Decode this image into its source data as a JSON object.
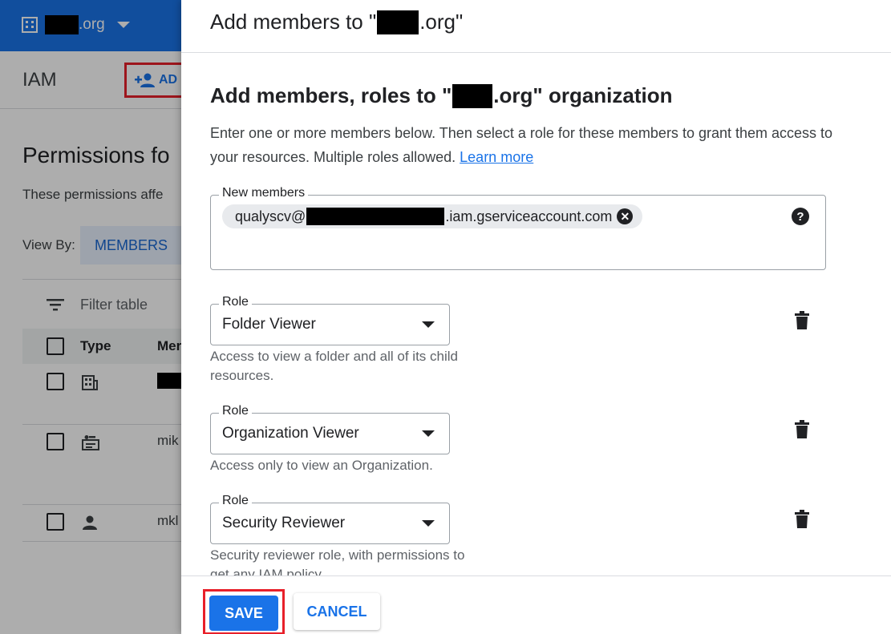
{
  "background": {
    "org_suffix": ".org",
    "iam_title": "IAM",
    "add_label": "AD",
    "permissions_title": "Permissions fo",
    "permissions_desc": "These permissions affe",
    "view_by_label": "View By:",
    "members_tab": "MEMBERS",
    "filter_placeholder": "Filter table",
    "columns": {
      "type": "Type",
      "member": "Mer"
    },
    "rows": [
      {
        "icon": "building-icon",
        "member": ""
      },
      {
        "icon": "service-account-icon",
        "member": "mik"
      },
      {
        "icon": "person-icon",
        "member": "mkl"
      }
    ]
  },
  "panel": {
    "title_prefix": "Add members to \"",
    "title_suffix": ".org\"",
    "section_prefix": "Add members, roles to \"",
    "section_suffix": ".org\" organization",
    "intro": "Enter one or more members below. Then select a role for these members to grant them access to your resources. Multiple roles allowed.",
    "learn_more": "Learn more",
    "new_members_label": "New members",
    "member_chip": {
      "prefix": "qualyscv@",
      "suffix": ".iam.gserviceaccount.com"
    },
    "roles": [
      {
        "label": "Role",
        "value": "Folder Viewer",
        "description": "Access to view a folder and all of its child resources."
      },
      {
        "label": "Role",
        "value": "Organization Viewer",
        "description": "Access only to view an Organization."
      },
      {
        "label": "Role",
        "value": "Security Reviewer",
        "description": "Security reviewer role, with permissions to get any IAM policy."
      }
    ],
    "save_label": "SAVE",
    "cancel_label": "CANCEL"
  },
  "colors": {
    "primary": "#1a73e8",
    "highlight": "#e8202a",
    "scrim": "rgba(0,0,0,0.32)"
  }
}
